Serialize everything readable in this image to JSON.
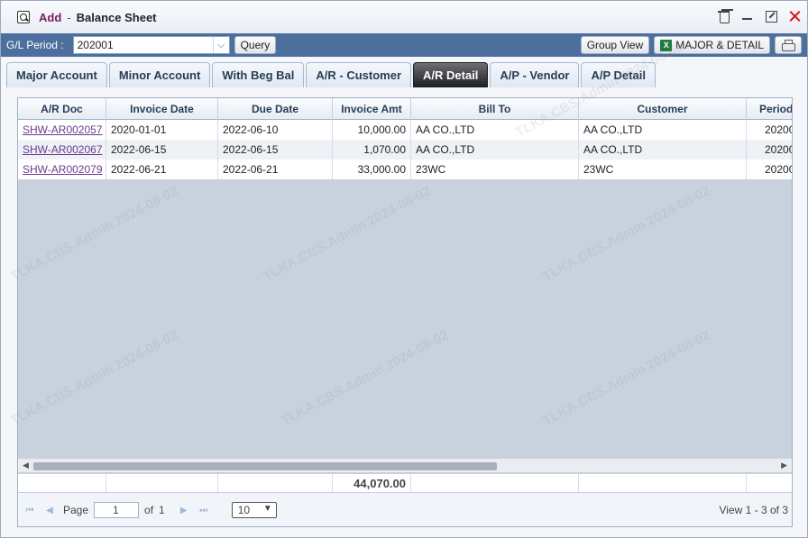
{
  "window": {
    "mode": "Add",
    "separator": "-",
    "title": "Balance Sheet"
  },
  "toolbar": {
    "period_label": "G/L Period :",
    "period_value": "202001",
    "query_label": "Query",
    "group_view_label": "Group View",
    "major_detail_label": "MAJOR & DETAIL"
  },
  "tabs": [
    {
      "label": "Major Account",
      "active": false
    },
    {
      "label": "Minor Account",
      "active": false
    },
    {
      "label": "With Beg Bal",
      "active": false
    },
    {
      "label": "A/R - Customer",
      "active": false
    },
    {
      "label": "A/R Detail",
      "active": true
    },
    {
      "label": "A/P - Vendor",
      "active": false
    },
    {
      "label": "A/P Detail",
      "active": false
    }
  ],
  "grid": {
    "columns": [
      "A/R Doc",
      "Invoice Date",
      "Due Date",
      "Invoice Amt",
      "Bill To",
      "Customer",
      "Period"
    ],
    "rows": [
      {
        "doc": "SHW-AR002057",
        "invoice_date": "2020-01-01",
        "due_date": "2022-06-10",
        "amt": "10,000.00",
        "bill_to": "AA CO.,LTD",
        "customer": "AA CO.,LTD",
        "period": "20200"
      },
      {
        "doc": "SHW-AR002067",
        "invoice_date": "2022-06-15",
        "due_date": "2022-06-15",
        "amt": "1,070.00",
        "bill_to": "AA CO.,LTD",
        "customer": "AA CO.,LTD",
        "period": "20200"
      },
      {
        "doc": "SHW-AR002079",
        "invoice_date": "2022-06-21",
        "due_date": "2022-06-21",
        "amt": "33,000.00",
        "bill_to": "23WC",
        "customer": "23WC",
        "period": "20200"
      }
    ],
    "total_amt": "44,070.00"
  },
  "pager": {
    "page_label": "Page",
    "page_value": "1",
    "of_label": "of",
    "total_pages": "1",
    "page_size": "10",
    "view_text": "View 1 - 3 of 3"
  },
  "watermark_text": "TLKA.CBS.Admin 2024-08-02"
}
